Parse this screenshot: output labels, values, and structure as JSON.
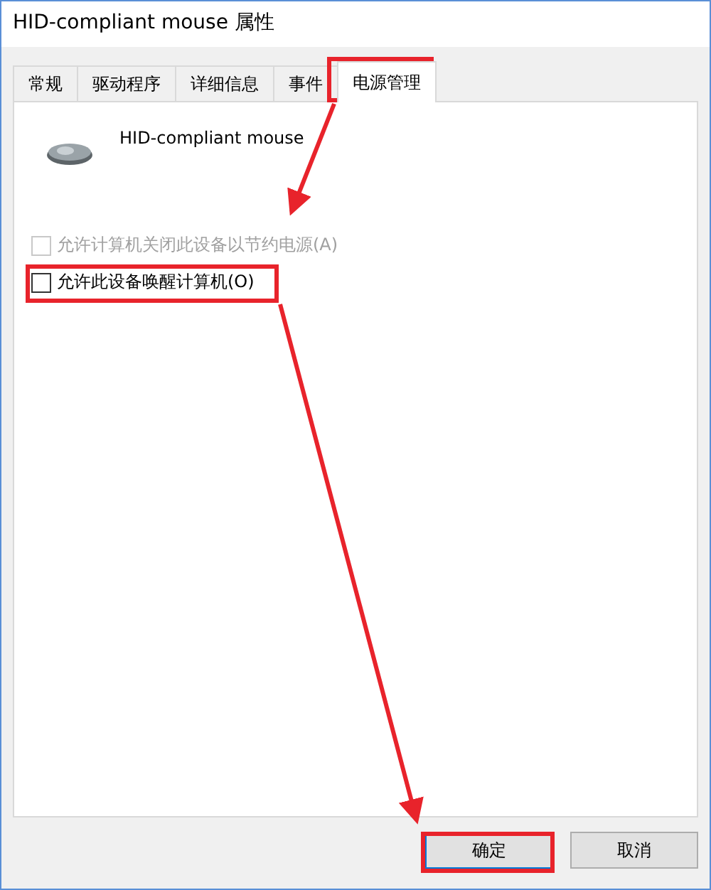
{
  "window": {
    "title": "HID-compliant mouse 属性"
  },
  "tabs": [
    {
      "label": "常规",
      "selected": false
    },
    {
      "label": "驱动程序",
      "selected": false
    },
    {
      "label": "详细信息",
      "selected": false
    },
    {
      "label": "事件",
      "selected": false
    },
    {
      "label": "电源管理",
      "selected": true
    }
  ],
  "device": {
    "name": "HID-compliant mouse"
  },
  "options": [
    {
      "label": "允许计算机关闭此设备以节约电源(A)",
      "checked": false,
      "disabled": true
    },
    {
      "label": "允许此设备唤醒计算机(O)",
      "checked": false,
      "disabled": false
    }
  ],
  "buttons": [
    {
      "label": "确定",
      "kind": "default"
    },
    {
      "label": "取消",
      "kind": "normal"
    }
  ]
}
